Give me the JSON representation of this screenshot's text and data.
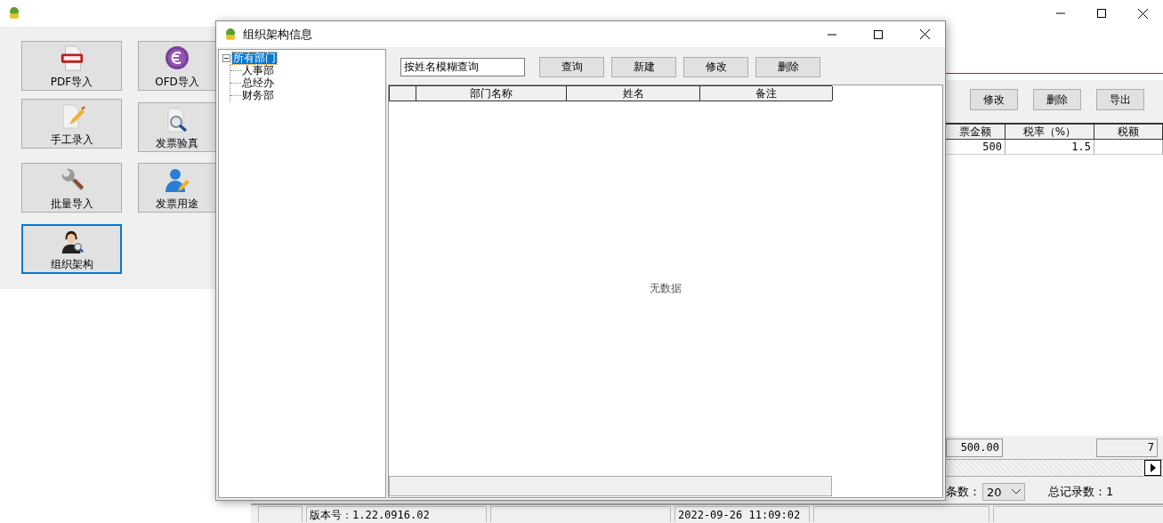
{
  "main_window": {
    "tools": [
      {
        "label": "PDF导入",
        "kind": "pdf",
        "selected": false
      },
      {
        "label": "OFD导入",
        "kind": "coin",
        "selected": false
      },
      {
        "label": "手工录入",
        "kind": "edit",
        "selected": false
      },
      {
        "label": "发票验真",
        "kind": "inspect",
        "selected": false
      },
      {
        "label": "批量导入",
        "kind": "wrench",
        "selected": false
      },
      {
        "label": "发票用途",
        "kind": "person-edit",
        "selected": false
      },
      {
        "label": "组织架构",
        "kind": "person-search",
        "selected": true
      }
    ],
    "actions": [
      "修改",
      "删除",
      "导出"
    ],
    "table": {
      "columns": [
        "票金额",
        "税率（%）",
        "税额"
      ],
      "rows": [
        {
          "cells": [
            "500",
            "1.5"
          ]
        }
      ]
    },
    "totals": [
      "500.00",
      "7"
    ],
    "pager": {
      "label": "条数：",
      "page_size": "20",
      "total": "总记录数：1"
    },
    "status_bar": {
      "version": "版本号：1.22.0916.02",
      "datetime": "2022-09-26 11:09:02"
    }
  },
  "dialog": {
    "title": "组织架构信息",
    "tree": {
      "label": "所有部门",
      "expanded": true,
      "selected": true,
      "children": [
        {
          "label": "人事部",
          "selected": false
        },
        {
          "label": "总经办",
          "selected": false
        },
        {
          "label": "财务部",
          "selected": false
        }
      ]
    },
    "search": {
      "value": "按姓名模糊查询"
    },
    "buttons": [
      "查询",
      "新建",
      "修改",
      "删除"
    ],
    "table": {
      "columns": [
        "部门名称",
        "姓名",
        "备注"
      ],
      "empty_text": "无数据"
    }
  }
}
